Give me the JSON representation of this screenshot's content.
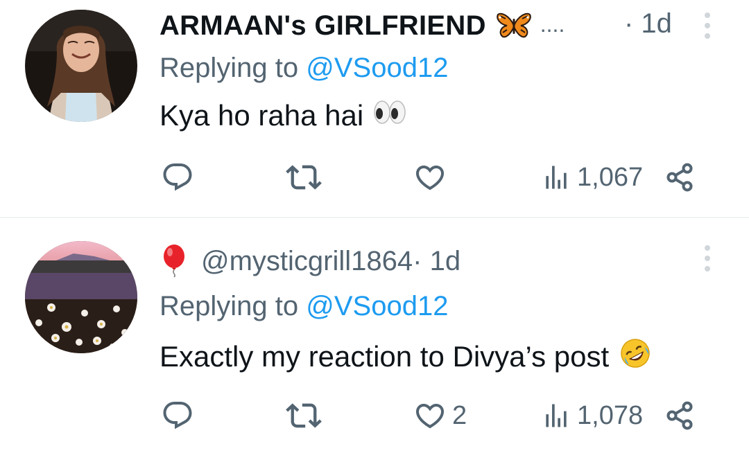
{
  "tweets": [
    {
      "display_name": "ARMAAN's GIRLFRIEND",
      "name_suffix": "....",
      "name_emoji": "butterfly-emoji",
      "time": "· 1d",
      "replying_prefix": "Replying to",
      "replying_handle": "@VSood12",
      "text": "Kya ho raha hai",
      "text_emoji": "eyes-emoji",
      "likes": "",
      "views": "1,067"
    },
    {
      "handle_emoji": "balloon-emoji",
      "handle": "@mysticgrill1864",
      "time": " · 1d",
      "replying_prefix": "Replying to",
      "replying_handle": "@VSood12",
      "text": "Exactly my reaction to Divya’s post",
      "text_emoji": "rofl-emoji",
      "likes": "2",
      "views": "1,078"
    }
  ],
  "colors": {
    "text": "#0f1419",
    "secondary": "#536471",
    "link": "#1d9bf0",
    "divider": "#eff3f4"
  }
}
